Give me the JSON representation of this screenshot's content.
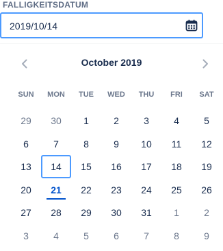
{
  "field": {
    "label": "FALLIGKEITSDATUM",
    "value": "2019/10/14",
    "icon": "calendar-icon"
  },
  "picker": {
    "month_label": "October 2019",
    "prev_icon": "chevron-left-icon",
    "next_icon": "chevron-right-icon",
    "weekdays": [
      "SUN",
      "MON",
      "TUE",
      "WED",
      "THU",
      "FRI",
      "SAT"
    ],
    "weeks": [
      [
        {
          "d": "29",
          "m": true
        },
        {
          "d": "30",
          "m": true
        },
        {
          "d": "1"
        },
        {
          "d": "2"
        },
        {
          "d": "3"
        },
        {
          "d": "4"
        },
        {
          "d": "5"
        }
      ],
      [
        {
          "d": "6"
        },
        {
          "d": "7"
        },
        {
          "d": "8"
        },
        {
          "d": "9"
        },
        {
          "d": "10"
        },
        {
          "d": "11"
        },
        {
          "d": "12"
        }
      ],
      [
        {
          "d": "13"
        },
        {
          "d": "14",
          "selected": true
        },
        {
          "d": "15"
        },
        {
          "d": "16"
        },
        {
          "d": "17"
        },
        {
          "d": "18"
        },
        {
          "d": "19"
        }
      ],
      [
        {
          "d": "20"
        },
        {
          "d": "21",
          "today": true
        },
        {
          "d": "22"
        },
        {
          "d": "23"
        },
        {
          "d": "24"
        },
        {
          "d": "25"
        },
        {
          "d": "26"
        }
      ],
      [
        {
          "d": "27"
        },
        {
          "d": "28"
        },
        {
          "d": "29"
        },
        {
          "d": "30"
        },
        {
          "d": "31"
        },
        {
          "d": "1",
          "m": true
        },
        {
          "d": "2",
          "m": true
        }
      ],
      [
        {
          "d": "3",
          "m": true
        },
        {
          "d": "4",
          "m": true
        },
        {
          "d": "5",
          "m": true
        },
        {
          "d": "6",
          "m": true
        },
        {
          "d": "7",
          "m": true
        },
        {
          "d": "8",
          "m": true
        },
        {
          "d": "9",
          "m": true
        }
      ]
    ]
  },
  "colors": {
    "accent": "#4c9aff",
    "today": "#0052cc",
    "text": "#172b4d",
    "muted": "#6b778c"
  }
}
